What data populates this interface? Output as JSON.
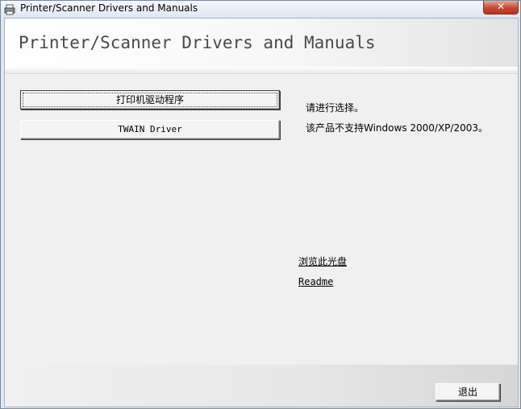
{
  "window": {
    "title": "Printer/Scanner Drivers and Manuals",
    "close_label": "✕"
  },
  "header": {
    "title": "Printer/Scanner Drivers and Manuals"
  },
  "buttons": {
    "printer_driver": "打印机驱动程序",
    "twain_driver": "TWAIN Driver"
  },
  "info": {
    "prompt": "请进行选择。",
    "notice": "该产品不支持Windows 2000/XP/2003。"
  },
  "links": {
    "browse_disc": "浏览此光盘",
    "readme": "Readme"
  },
  "footer": {
    "exit_label": "退出"
  },
  "icons": {
    "app": "printer-icon",
    "close": "close-icon"
  },
  "colors": {
    "close_button": "#c8452e",
    "window_frame": "#dfe7f0",
    "client_bg": "#f0f0f0"
  }
}
